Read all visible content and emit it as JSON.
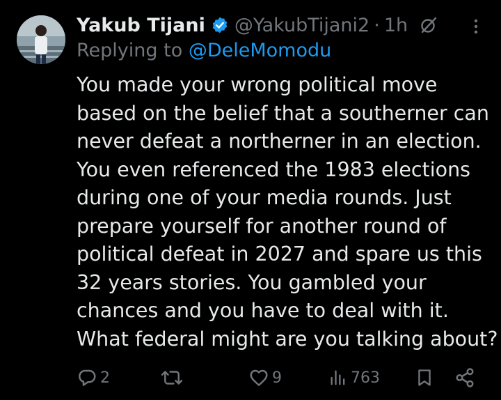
{
  "tweet": {
    "author_name": "Yakub Tijani",
    "handle": "@YakubTijani2",
    "separator": "·",
    "time": "1h",
    "replying_prefix": "Replying to ",
    "replying_to": "@DeleMomodu",
    "body_lines": [
      "You made your wrong political move",
      "based on the belief that a southerner can",
      "never defeat a northerner in an election.",
      "You even referenced the 1983 elections",
      "during one of your media rounds. Just",
      "prepare yourself for another round of",
      "political defeat in 2027 and spare us this",
      "32 years stories. You gambled your",
      "chances and you have to deal with it.",
      "What federal might are you talking about?"
    ]
  },
  "actions": {
    "replies": "2",
    "retweets": "",
    "likes": "9",
    "views": "763"
  },
  "icons": {
    "verified": "verified-badge-icon",
    "grok": "grok-icon",
    "more": "more-vertical-icon",
    "reply": "reply-icon",
    "retweet": "retweet-icon",
    "like": "heart-icon",
    "views": "views-chart-icon",
    "bookmark": "bookmark-icon",
    "share": "share-icon"
  },
  "colors": {
    "background": "#000000",
    "text_primary": "#e7e9ea",
    "text_secondary": "#71767b",
    "accent": "#1d9bf0"
  }
}
